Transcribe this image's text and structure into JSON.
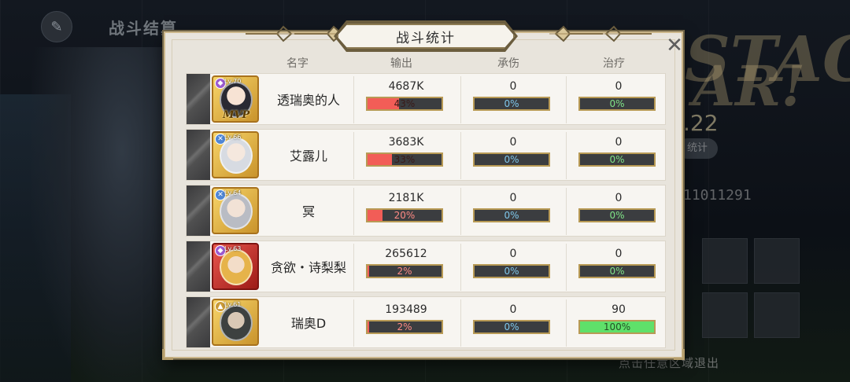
{
  "background": {
    "header_title": "战斗结算",
    "banner_line1": "STAGE",
    "banner_line2": "AR!",
    "banner_date": ".22",
    "pill_text": "统计",
    "player_id": "11011291",
    "exit_hint": "点击任意区域退出"
  },
  "panel": {
    "title": "战斗统计",
    "close_glyph": "✕",
    "columns": {
      "name": "名字",
      "output": "输出",
      "damage_taken": "承伤",
      "healing": "治疗"
    }
  },
  "colors": {
    "output_bar": "#f25d57",
    "healing_bar": "#5fe06a",
    "bar_border": "#b89a55"
  },
  "rows": [
    {
      "name": "透瑞奥的人",
      "level": "Lv.70",
      "element_icon": "purple-gem-icon",
      "rarity": "gold",
      "mvp": "MVP",
      "output": "4687K",
      "output_pct": "43%",
      "output_fraction": 0.43,
      "damage_taken": "0",
      "damage_pct": "0%",
      "healing": "0",
      "healing_pct": "0%",
      "healing_fraction": 0
    },
    {
      "name": "艾露儿",
      "level": "Lv.66",
      "element_icon": "blue-cross-icon",
      "rarity": "gold",
      "mvp": "",
      "output": "3683K",
      "output_pct": "33%",
      "output_fraction": 0.33,
      "damage_taken": "0",
      "damage_pct": "0%",
      "healing": "0",
      "healing_pct": "0%",
      "healing_fraction": 0
    },
    {
      "name": "冥",
      "level": "Lv.64",
      "element_icon": "blue-cross-icon",
      "rarity": "gold",
      "mvp": "",
      "output": "2181K",
      "output_pct": "20%",
      "output_fraction": 0.2,
      "damage_taken": "0",
      "damage_pct": "0%",
      "healing": "0",
      "healing_pct": "0%",
      "healing_fraction": 0
    },
    {
      "name": "贪欲・诗梨梨",
      "level": "Lv.63",
      "element_icon": "purple-gem-icon",
      "rarity": "red",
      "mvp": "",
      "output": "265612",
      "output_pct": "2%",
      "output_fraction": 0.02,
      "damage_taken": "0",
      "damage_pct": "0%",
      "healing": "0",
      "healing_pct": "0%",
      "healing_fraction": 0
    },
    {
      "name": "瑞奥D",
      "level": "Lv.61",
      "element_icon": "gold-staff-icon",
      "rarity": "gold",
      "mvp": "",
      "output": "193489",
      "output_pct": "2%",
      "output_fraction": 0.02,
      "damage_taken": "0",
      "damage_pct": "0%",
      "healing": "90",
      "healing_pct": "100%",
      "healing_fraction": 1.0
    }
  ]
}
